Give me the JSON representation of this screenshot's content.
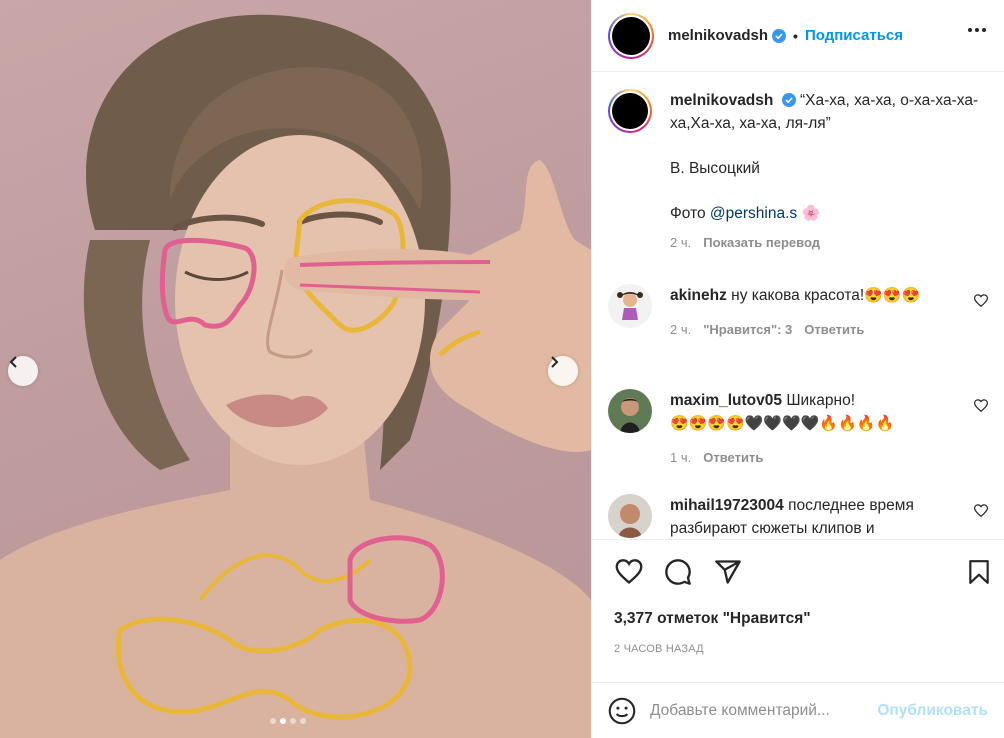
{
  "post": {
    "username": "melnikovadsh",
    "follow_label": "Подписаться",
    "separator": "•"
  },
  "caption": {
    "username": "melnikovadsh",
    "text": "“Ха-ха, ха-ха, о-ха-ха-ха-ха,Ха-ха, ха-ха, ля-ля”",
    "author": "В. Высоцкий",
    "photo_prefix": "Фото",
    "photo_mention": "@pershina.s",
    "photo_emoji": "🌸",
    "time": "2 ч.",
    "translate": "Показать перевод"
  },
  "comments": [
    {
      "username": "akinehz",
      "text": "ну какова красота!",
      "emojis": "😍😍😍",
      "time": "2 ч.",
      "likes": "\"Нравится\": 3",
      "reply": "Ответить"
    },
    {
      "username": "maxim_lutov05",
      "text": "Шикарно!",
      "emojis": "😍😍😍😍🖤🖤🖤🖤🔥🔥🔥🔥",
      "time": "1 ч.",
      "reply": "Ответить"
    },
    {
      "username": "mihail19723004",
      "text": "последнее время разбирают сюжеты клипов и"
    }
  ],
  "likes_count": "3,377 отметок \"Нравится\"",
  "time_ago": "2 ЧАСОВ НАЗАД",
  "add_comment": {
    "placeholder": "Добавьте комментарий...",
    "publish_label": "Опубликовать"
  },
  "carousel": {
    "total": 4,
    "active_index": 2
  },
  "colors": {
    "accent": "#0095f6",
    "publish_disabled": "#b2dffc",
    "muted": "#8e8e8e",
    "text": "#262626",
    "photo_background": "#c4a2a4"
  },
  "icons": [
    "chevron-left-icon",
    "chevron-right-icon",
    "verified-badge-icon",
    "more-icon",
    "heart-icon",
    "comment-icon",
    "share-icon",
    "bookmark-icon",
    "emoji-icon"
  ]
}
